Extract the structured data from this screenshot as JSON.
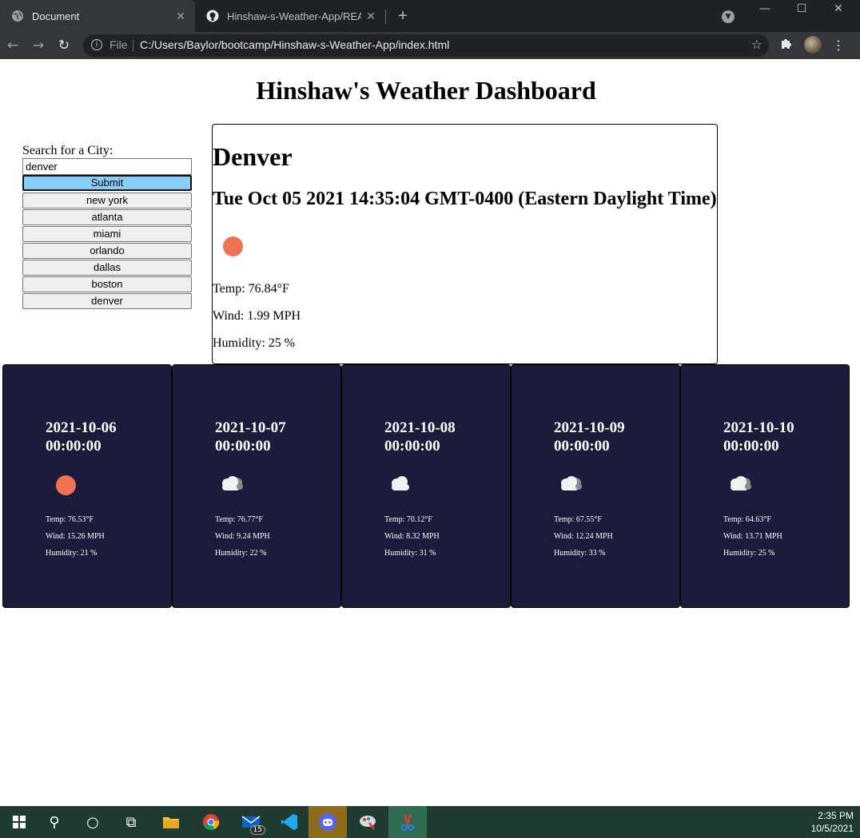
{
  "browser": {
    "tabs": [
      {
        "label": "Document",
        "active": true
      },
      {
        "label": "Hinshaw-s-Weather-App/READM",
        "active": false
      }
    ],
    "new_tab": "+",
    "scheme": "File",
    "url": "C:/Users/Baylor/bootcamp/Hinshaw-s-Weather-App/index.html"
  },
  "page": {
    "title": "Hinshaw's Weather Dashboard",
    "search_label": "Search for a City:",
    "search_value": "denver",
    "submit_label": "Submit",
    "history": [
      "new york",
      "atlanta",
      "miami",
      "orlando",
      "dallas",
      "boston",
      "denver"
    ]
  },
  "current": {
    "city": "Denver",
    "date": "Tue Oct 05 2021 14:35:04 GMT-0400 (Eastern Daylight Time)",
    "icon": "clear-sun-icon",
    "temp": "Temp: 76.84°F",
    "wind": "Wind: 1.99 MPH",
    "humidity": "Humidity: 25 %"
  },
  "forecast": [
    {
      "date": "2021-10-06",
      "time": "00:00:00",
      "icon": "clear-sun-icon",
      "temp": "Temp: 76.53°F",
      "wind": "Wind: 15.26 MPH",
      "humidity": "Humidity: 21 %"
    },
    {
      "date": "2021-10-07",
      "time": "00:00:00",
      "icon": "broken-clouds-icon",
      "temp": "Temp: 76.77°F",
      "wind": "Wind: 9.24 MPH",
      "humidity": "Humidity: 22 %"
    },
    {
      "date": "2021-10-08",
      "time": "00:00:00",
      "icon": "cloud-icon",
      "temp": "Temp: 70.12°F",
      "wind": "Wind: 8.32 MPH",
      "humidity": "Humidity: 31 %"
    },
    {
      "date": "2021-10-09",
      "time": "00:00:00",
      "icon": "broken-clouds-icon",
      "temp": "Temp: 67.55°F",
      "wind": "Wind: 12.24 MPH",
      "humidity": "Humidity: 33 %"
    },
    {
      "date": "2021-10-10",
      "time": "00:00:00",
      "icon": "broken-clouds-icon",
      "temp": "Temp: 64.63°F",
      "wind": "Wind: 13.71 MPH",
      "humidity": "Humidity: 25 %"
    }
  ],
  "taskbar": {
    "mail_badge": "15",
    "time": "2:35 PM",
    "date": "10/5/2021"
  },
  "colors": {
    "card_bg": "#1c1b3b",
    "sun": "#ef7254",
    "submit_bg": "#87cefa"
  }
}
